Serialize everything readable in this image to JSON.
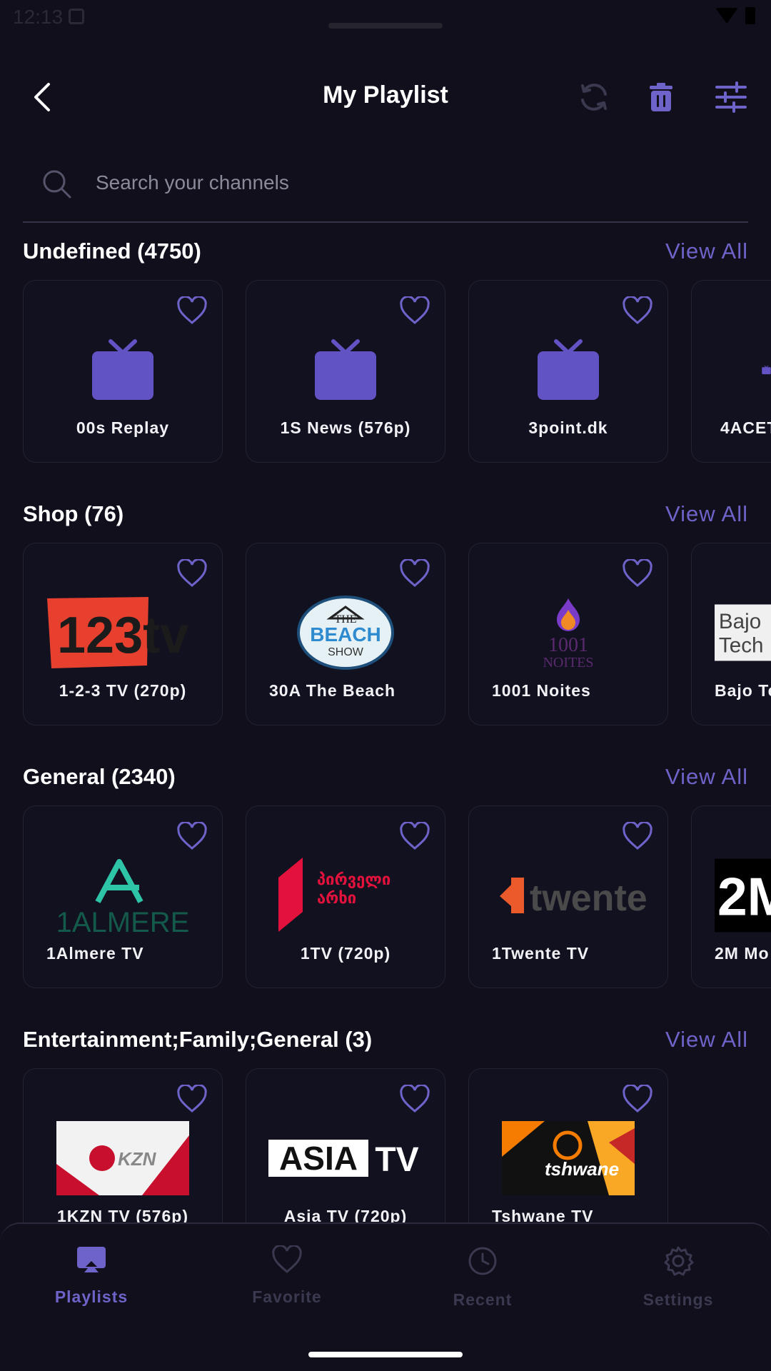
{
  "status": {
    "time": "12:13"
  },
  "header": {
    "title": "My Playlist"
  },
  "search": {
    "placeholder": "Search your channels"
  },
  "sections": [
    {
      "title": "Undefined (4750)",
      "view_all": "View All",
      "items": [
        {
          "name": "00s Replay"
        },
        {
          "name": "1S News (576p)"
        },
        {
          "name": "3point.dk"
        },
        {
          "name": "4ACET"
        }
      ]
    },
    {
      "title": "Shop (76)",
      "view_all": "View All",
      "items": [
        {
          "name": "1-2-3 TV (270p)",
          "logo_text": "123tv"
        },
        {
          "name": "30A The Beach",
          "logo_text": [
            "THE",
            "BEACH",
            "SHOW"
          ]
        },
        {
          "name": "1001 Noites",
          "logo_text": [
            "1001",
            "NOITES"
          ]
        },
        {
          "name": "Bajo Te",
          "logo_text": [
            "Bajo",
            "Tech"
          ]
        }
      ]
    },
    {
      "title": "General (2340)",
      "view_all": "View All",
      "items": [
        {
          "name": "1Almere TV",
          "logo_text": "1ALMERE"
        },
        {
          "name": "1TV (720p)",
          "logo_text": [
            "პირველი",
            "არხი"
          ]
        },
        {
          "name": "1Twente TV",
          "logo_text": "twente"
        },
        {
          "name": "2M Mo",
          "logo_text": "2M"
        }
      ]
    },
    {
      "title": "Entertainment;Family;General (3)",
      "view_all": "View All",
      "items": [
        {
          "name": "1KZN TV (576p)",
          "logo_text": "KZN"
        },
        {
          "name": "Asia TV (720p)",
          "logo_text": [
            "ASIA",
            "TV"
          ]
        },
        {
          "name": "Tshwane TV",
          "logo_text": "tshwane"
        }
      ]
    }
  ],
  "nav": [
    {
      "label": "Playlists",
      "active": true
    },
    {
      "label": "Favorite",
      "active": false
    },
    {
      "label": "Recent",
      "active": false
    },
    {
      "label": "Settings",
      "active": false
    }
  ],
  "colors": {
    "accent": "#6e63c9",
    "background": "#100f1b",
    "card": "#121120",
    "inactive_nav": "#3a3950"
  }
}
